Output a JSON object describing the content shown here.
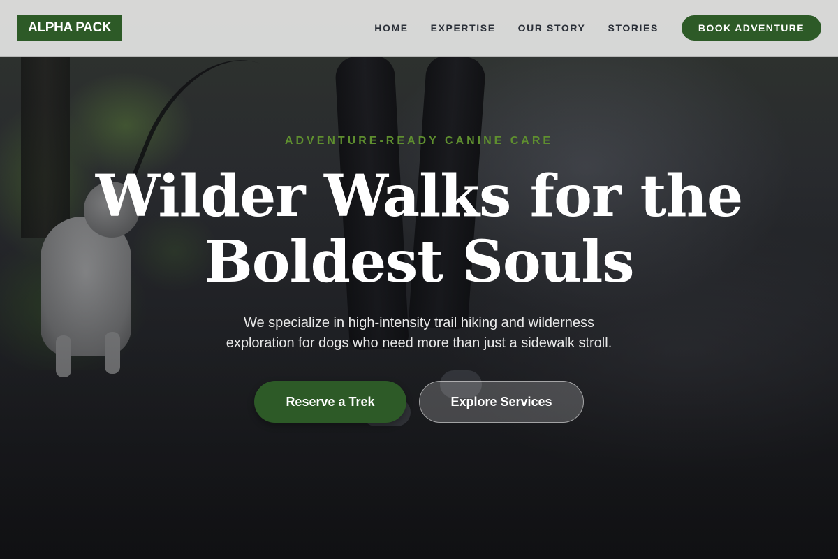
{
  "brand": {
    "logo_text": "ALPHA PACK",
    "accent_color": "#2d5a27"
  },
  "nav": {
    "items": [
      {
        "label": "HOME"
      },
      {
        "label": "EXPERTISE"
      },
      {
        "label": "OUR STORY"
      },
      {
        "label": "STORIES"
      }
    ],
    "cta_label": "BOOK ADVENTURE"
  },
  "hero": {
    "eyebrow": "ADVENTURE-READY CANINE CARE",
    "headline_line1": "Wilder Walks for the",
    "headline_line2": "Boldest Souls",
    "subtext_line1": "We specialize in high-intensity trail hiking and wilderness",
    "subtext_line2": "exploration for dogs who need more than just a sidewalk stroll.",
    "primary_button": "Reserve a Trek",
    "secondary_button": "Explore Services"
  }
}
